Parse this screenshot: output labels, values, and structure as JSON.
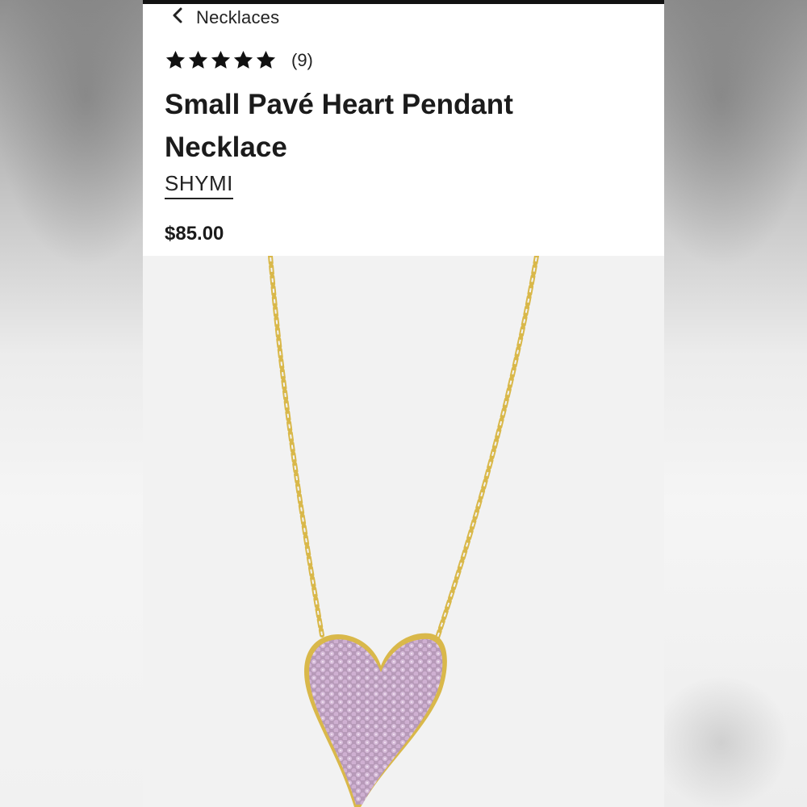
{
  "navigation": {
    "back_label": "Necklaces"
  },
  "product": {
    "rating": {
      "stars": 5,
      "max_stars": 5,
      "review_count": "(9)"
    },
    "title": "Small Pavé Heart Pendant Necklace",
    "brand": "SHYMI",
    "price": "$85.00",
    "image": {
      "subject": "gold chain necklace with pink pavé heart pendant",
      "chain_color": "#d9b84a",
      "stone_color": "#c9a8cf"
    }
  },
  "colors": {
    "text": "#1b1b1b",
    "header_bg": "#ffffff",
    "image_bg": "#f2f2f2"
  }
}
